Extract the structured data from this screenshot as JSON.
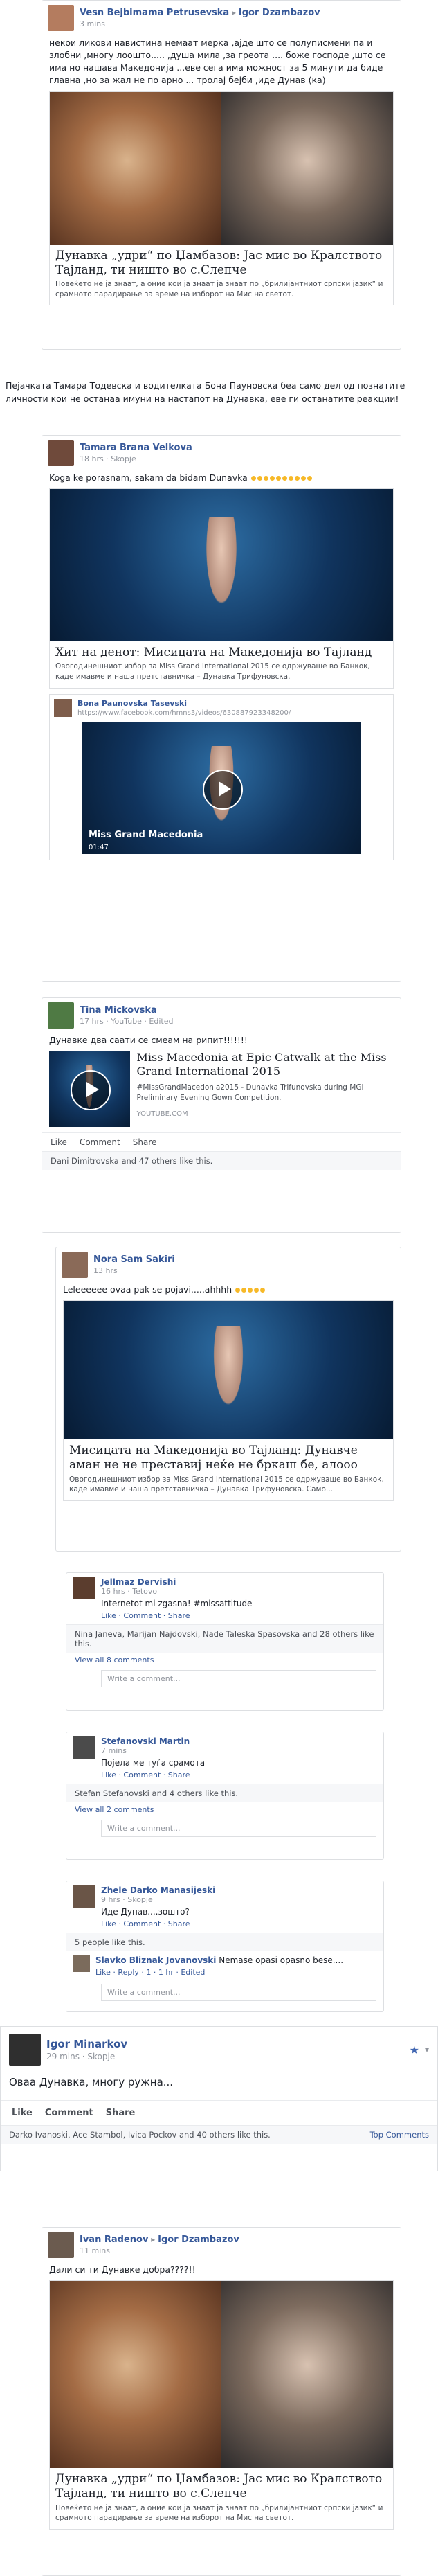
{
  "posts": [
    {
      "author": "Vesn Bejbimama Petrusevska",
      "target": "Igor Dzambazov",
      "time": "3 mins",
      "text": "некои ликови навистина немаат мерка ,ајде што се полуписмени па и злобни ,многу лоошто..... ,душа мила ,за греота .... боже господе ,што се има но нашава Македонија ...еве сега има можност за 5 минути да биде главна ,но за жал не по арно ... тролај бејби ,иде Дунав (ка)",
      "link_title": "Дунавка „удри“ по Џамбазов: Јас мис во Кралството Тајланд, ти ништо во с.Слепче",
      "link_desc": "Повеќето не ја знаат, а оние кои ја знаат ја знаат по „брилијантниот српски јазик“ и срамното парадирање за време на изборот на Мис на светот."
    },
    {
      "caption": "Пејачката Тамара Тодевска и водителката Бона Пауновска беа само дел од познатите личности кои не останаа имуни на настапот на Дунавка, еве ги останатите реакции!"
    },
    {
      "author": "Tamara Brana Velkova",
      "time": "18 hrs · Skopje",
      "text": "Koga ke porasnam, sakam da bidam Dunavka",
      "link_title": "Хит на денот: Мисицата на Македонија во Тајланд",
      "link_desc": "Овогодинешниот избор за Miss Grand International 2015 се одржуваше во Банкок, каде имавме и наша претставничка – Дунавка Трифуновска.",
      "share_name": "Bona Paunovska Tasevski",
      "share_url": "https://www.facebook.com/hmns3/videos/630887923348200/",
      "video_label": "Miss Grand Macedonia",
      "video_time": "01:47"
    },
    {
      "author": "Tina Mickovska",
      "time": "17 hrs · YouTube · Edited",
      "text": "Дунавке два саати се смеам на рипит!!!!!!!",
      "yt_title": "Miss Macedonia at Epic Catwalk at the Miss Grand International 2015",
      "yt_desc": "#MissGrandMacedonia2015 - Dunavka Trifunovska during MGI Preliminary Evening Gown Competition.",
      "yt_src": "YOUTUBE.COM",
      "likes": "Dani Dimitrovska and 47 others like this."
    },
    {
      "author": "Nora Sam Sakiri",
      "time": "13 hrs",
      "text": "Leleeeeee ovaa pak se pojavi.....ahhhh",
      "link_title": "Мисицата на Македонија во Тајланд: Дунавче аман не не преставиј неќе не бркаш бе, алооо",
      "link_desc": "Овогодинешниот избор за Miss Grand International 2015 се одржуваше во Банкок, каде имавме и наша претставничка – Дунавка Трифуновска. Само..."
    }
  ],
  "comments": [
    {
      "name": "Jellmaz Dervishi",
      "meta": "16 hrs · Tetovo",
      "text": "Internetot mi zgasna! #missattitude",
      "links": "Like · Comment · Share",
      "likes": "Nina Janeva, Marijan Najdovski, Nade Taleska Spasovska and 28 others like this.",
      "view": "View all 8 comments",
      "write": "Write a comment..."
    },
    {
      "name": "Stefanovski Martin",
      "meta": "7 mins",
      "text": "Појела ме туѓа срамота",
      "links": "Like · Comment · Share",
      "likes": "Stefan Stefanovski and 4 others like this.",
      "view": "View all 2 comments",
      "write": "Write a comment..."
    },
    {
      "name": "Zhele Darko Manasijeski",
      "meta": "9 hrs · Skopje",
      "text": "Иде Дунав....зошто?",
      "links": "Like · Comment · Share",
      "likes": "5 people like this.",
      "reply_name": "Slavko Bliznak Jovanovski",
      "reply_text": "Nemase opasi opasno bese....",
      "reply_meta": "Like · Reply · 1 · 1 hr · Edited",
      "write": "Write a comment..."
    }
  ],
  "igor": {
    "name": "Igor Minarkov",
    "time": "29 mins · Skopje",
    "text": "Оваа Дунавка, многу ружна...",
    "actions": [
      "Like",
      "Comment",
      "Share"
    ],
    "likes": "Darko Ivanoski, Ace Stambol, Ivica Pockov and 40 others like this.",
    "top": "Top Comments"
  },
  "ivan": {
    "author": "Ivan Radenov",
    "target": "Igor Dzambazov",
    "time": "11 mins",
    "text": "Дали си ти Дунавке добра????!!",
    "link_title": "Дунавка „удри“ по Џамбазов: Јас мис во Кралството Тајланд, ти ништо во с.Слепче",
    "link_desc": "Повеќето не ја знаат, а оние кои ја знаат ја знаат по „брилијантниот српски јазик“ и срамното парадирање за време на изборот на Мис на светот."
  },
  "ui": {
    "like": "Like",
    "comment": "Comment",
    "share": "Share"
  }
}
